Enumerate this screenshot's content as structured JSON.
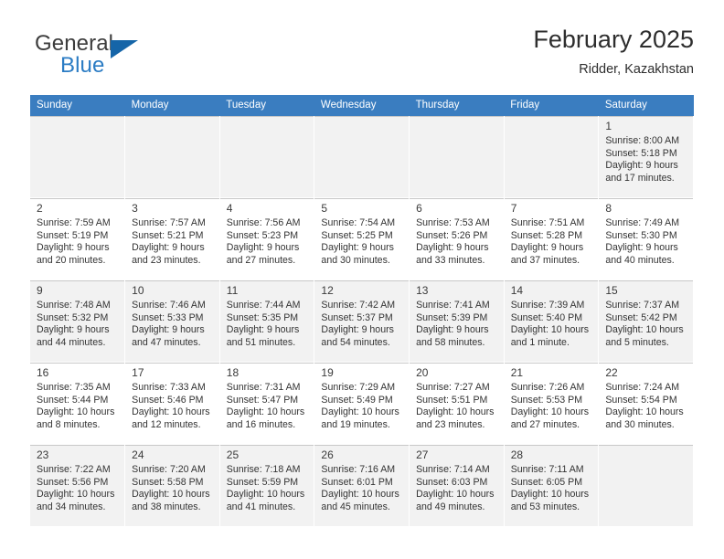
{
  "brand": {
    "name_part1": "General",
    "name_part2": "Blue",
    "logo_icon": "triangle-flag-icon"
  },
  "header": {
    "title": "February 2025",
    "subtitle": "Ridder, Kazakhstan"
  },
  "colors": {
    "header_bar": "#3a7dc0",
    "brand_blue": "#2b7cc4",
    "logo_triangle": "#1565a8",
    "row_alt": "#f2f2f2",
    "grid_line": "#c8c8c8"
  },
  "weekdays": [
    "Sunday",
    "Monday",
    "Tuesday",
    "Wednesday",
    "Thursday",
    "Friday",
    "Saturday"
  ],
  "weeks": [
    [
      {
        "day": "",
        "empty": true
      },
      {
        "day": "",
        "empty": true
      },
      {
        "day": "",
        "empty": true
      },
      {
        "day": "",
        "empty": true
      },
      {
        "day": "",
        "empty": true
      },
      {
        "day": "",
        "empty": true
      },
      {
        "day": "1",
        "sunrise": "Sunrise: 8:00 AM",
        "sunset": "Sunset: 5:18 PM",
        "daylight1": "Daylight: 9 hours",
        "daylight2": "and 17 minutes."
      }
    ],
    [
      {
        "day": "2",
        "sunrise": "Sunrise: 7:59 AM",
        "sunset": "Sunset: 5:19 PM",
        "daylight1": "Daylight: 9 hours",
        "daylight2": "and 20 minutes."
      },
      {
        "day": "3",
        "sunrise": "Sunrise: 7:57 AM",
        "sunset": "Sunset: 5:21 PM",
        "daylight1": "Daylight: 9 hours",
        "daylight2": "and 23 minutes."
      },
      {
        "day": "4",
        "sunrise": "Sunrise: 7:56 AM",
        "sunset": "Sunset: 5:23 PM",
        "daylight1": "Daylight: 9 hours",
        "daylight2": "and 27 minutes."
      },
      {
        "day": "5",
        "sunrise": "Sunrise: 7:54 AM",
        "sunset": "Sunset: 5:25 PM",
        "daylight1": "Daylight: 9 hours",
        "daylight2": "and 30 minutes."
      },
      {
        "day": "6",
        "sunrise": "Sunrise: 7:53 AM",
        "sunset": "Sunset: 5:26 PM",
        "daylight1": "Daylight: 9 hours",
        "daylight2": "and 33 minutes."
      },
      {
        "day": "7",
        "sunrise": "Sunrise: 7:51 AM",
        "sunset": "Sunset: 5:28 PM",
        "daylight1": "Daylight: 9 hours",
        "daylight2": "and 37 minutes."
      },
      {
        "day": "8",
        "sunrise": "Sunrise: 7:49 AM",
        "sunset": "Sunset: 5:30 PM",
        "daylight1": "Daylight: 9 hours",
        "daylight2": "and 40 minutes."
      }
    ],
    [
      {
        "day": "9",
        "sunrise": "Sunrise: 7:48 AM",
        "sunset": "Sunset: 5:32 PM",
        "daylight1": "Daylight: 9 hours",
        "daylight2": "and 44 minutes."
      },
      {
        "day": "10",
        "sunrise": "Sunrise: 7:46 AM",
        "sunset": "Sunset: 5:33 PM",
        "daylight1": "Daylight: 9 hours",
        "daylight2": "and 47 minutes."
      },
      {
        "day": "11",
        "sunrise": "Sunrise: 7:44 AM",
        "sunset": "Sunset: 5:35 PM",
        "daylight1": "Daylight: 9 hours",
        "daylight2": "and 51 minutes."
      },
      {
        "day": "12",
        "sunrise": "Sunrise: 7:42 AM",
        "sunset": "Sunset: 5:37 PM",
        "daylight1": "Daylight: 9 hours",
        "daylight2": "and 54 minutes."
      },
      {
        "day": "13",
        "sunrise": "Sunrise: 7:41 AM",
        "sunset": "Sunset: 5:39 PM",
        "daylight1": "Daylight: 9 hours",
        "daylight2": "and 58 minutes."
      },
      {
        "day": "14",
        "sunrise": "Sunrise: 7:39 AM",
        "sunset": "Sunset: 5:40 PM",
        "daylight1": "Daylight: 10 hours",
        "daylight2": "and 1 minute."
      },
      {
        "day": "15",
        "sunrise": "Sunrise: 7:37 AM",
        "sunset": "Sunset: 5:42 PM",
        "daylight1": "Daylight: 10 hours",
        "daylight2": "and 5 minutes."
      }
    ],
    [
      {
        "day": "16",
        "sunrise": "Sunrise: 7:35 AM",
        "sunset": "Sunset: 5:44 PM",
        "daylight1": "Daylight: 10 hours",
        "daylight2": "and 8 minutes."
      },
      {
        "day": "17",
        "sunrise": "Sunrise: 7:33 AM",
        "sunset": "Sunset: 5:46 PM",
        "daylight1": "Daylight: 10 hours",
        "daylight2": "and 12 minutes."
      },
      {
        "day": "18",
        "sunrise": "Sunrise: 7:31 AM",
        "sunset": "Sunset: 5:47 PM",
        "daylight1": "Daylight: 10 hours",
        "daylight2": "and 16 minutes."
      },
      {
        "day": "19",
        "sunrise": "Sunrise: 7:29 AM",
        "sunset": "Sunset: 5:49 PM",
        "daylight1": "Daylight: 10 hours",
        "daylight2": "and 19 minutes."
      },
      {
        "day": "20",
        "sunrise": "Sunrise: 7:27 AM",
        "sunset": "Sunset: 5:51 PM",
        "daylight1": "Daylight: 10 hours",
        "daylight2": "and 23 minutes."
      },
      {
        "day": "21",
        "sunrise": "Sunrise: 7:26 AM",
        "sunset": "Sunset: 5:53 PM",
        "daylight1": "Daylight: 10 hours",
        "daylight2": "and 27 minutes."
      },
      {
        "day": "22",
        "sunrise": "Sunrise: 7:24 AM",
        "sunset": "Sunset: 5:54 PM",
        "daylight1": "Daylight: 10 hours",
        "daylight2": "and 30 minutes."
      }
    ],
    [
      {
        "day": "23",
        "sunrise": "Sunrise: 7:22 AM",
        "sunset": "Sunset: 5:56 PM",
        "daylight1": "Daylight: 10 hours",
        "daylight2": "and 34 minutes."
      },
      {
        "day": "24",
        "sunrise": "Sunrise: 7:20 AM",
        "sunset": "Sunset: 5:58 PM",
        "daylight1": "Daylight: 10 hours",
        "daylight2": "and 38 minutes."
      },
      {
        "day": "25",
        "sunrise": "Sunrise: 7:18 AM",
        "sunset": "Sunset: 5:59 PM",
        "daylight1": "Daylight: 10 hours",
        "daylight2": "and 41 minutes."
      },
      {
        "day": "26",
        "sunrise": "Sunrise: 7:16 AM",
        "sunset": "Sunset: 6:01 PM",
        "daylight1": "Daylight: 10 hours",
        "daylight2": "and 45 minutes."
      },
      {
        "day": "27",
        "sunrise": "Sunrise: 7:14 AM",
        "sunset": "Sunset: 6:03 PM",
        "daylight1": "Daylight: 10 hours",
        "daylight2": "and 49 minutes."
      },
      {
        "day": "28",
        "sunrise": "Sunrise: 7:11 AM",
        "sunset": "Sunset: 6:05 PM",
        "daylight1": "Daylight: 10 hours",
        "daylight2": "and 53 minutes."
      },
      {
        "day": "",
        "empty": true
      }
    ]
  ]
}
